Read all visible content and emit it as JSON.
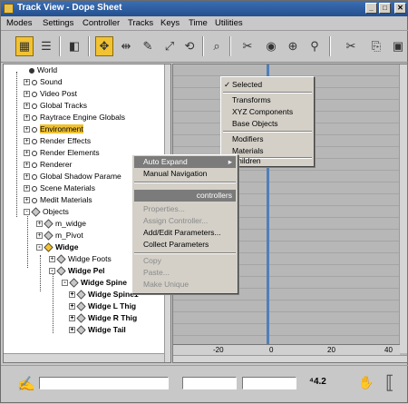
{
  "window": {
    "title": "Track View - Dope Sheet",
    "controls": [
      "_",
      "□",
      "✕"
    ]
  },
  "menubar": [
    "Modes",
    "Settings",
    "Controller",
    "Tracks",
    "Keys",
    "Time",
    "Utilities"
  ],
  "tree": [
    {
      "label": "World",
      "bold": false,
      "selected": false
    },
    {
      "label": "Sound",
      "bold": false,
      "selected": false
    },
    {
      "label": "Video Post",
      "bold": false,
      "selected": false
    },
    {
      "label": "Global Tracks",
      "bold": false,
      "selected": false
    },
    {
      "label": "Raytrace Engine Globals",
      "bold": false,
      "selected": false
    },
    {
      "label": "Environment",
      "bold": false,
      "selected": true
    },
    {
      "label": "Render Effects",
      "bold": false,
      "selected": false
    },
    {
      "label": "Render Elements",
      "bold": false,
      "selected": false
    },
    {
      "label": "Renderer",
      "bold": false,
      "selected": false
    },
    {
      "label": "Global Shadow Parame",
      "bold": false,
      "selected": false
    },
    {
      "label": "Scene Materials",
      "bold": false,
      "selected": false
    },
    {
      "label": "Medit Materials",
      "bold": false,
      "selected": false
    },
    {
      "label": "Objects",
      "bold": false,
      "selected": false
    },
    {
      "label": "m_widge",
      "bold": false,
      "selected": false
    },
    {
      "label": "m_Pivot",
      "bold": false,
      "selected": false
    },
    {
      "label": "Widge",
      "bold": true,
      "selected": false
    },
    {
      "label": "Widge Foots",
      "bold": false,
      "selected": false
    },
    {
      "label": "Widge Pel",
      "bold": true,
      "selected": false
    },
    {
      "label": "Widge Spine",
      "bold": true,
      "selected": false
    },
    {
      "label": "Widge Spine1",
      "bold": true,
      "selected": false
    },
    {
      "label": "Widge L Thig",
      "bold": true,
      "selected": false
    },
    {
      "label": "Widge R Thig",
      "bold": true,
      "selected": false
    },
    {
      "label": "Widge Tail",
      "bold": true,
      "selected": false
    }
  ],
  "expand_submenu": {
    "items": [
      {
        "label": "Selected",
        "checked": true
      },
      {
        "label": "Transforms",
        "checked": false
      },
      {
        "label": "XYZ Components",
        "checked": false
      },
      {
        "label": "Base Objects",
        "checked": false
      },
      {
        "label": "Modifiers",
        "checked": false
      },
      {
        "label": "Materials",
        "checked": false
      },
      {
        "label": "Children",
        "checked": false
      }
    ]
  },
  "context_menu": {
    "nav_items": [
      {
        "label": "Auto Expand",
        "highlighted": true
      },
      {
        "label": "Manual Navigation",
        "highlighted": false
      }
    ],
    "section_header": "controllers",
    "items": [
      {
        "label": "Properties...",
        "disabled": true
      },
      {
        "label": "Assign Controller...",
        "disabled": true
      },
      {
        "label": "Add/Edit Parameters...",
        "disabled": false
      },
      {
        "label": "Collect Parameters",
        "disabled": false
      },
      {
        "label": "Copy",
        "disabled": true
      },
      {
        "label": "Paste...",
        "disabled": true
      },
      {
        "label": "Make Unique",
        "disabled": true
      }
    ]
  },
  "ruler": [
    "-20",
    "0",
    "20",
    "40"
  ],
  "status": {
    "zoom_value": "4.2"
  }
}
